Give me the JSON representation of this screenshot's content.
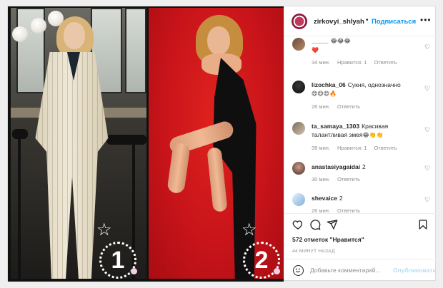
{
  "post": {
    "username": "zirkovyi_shlyah",
    "follow_label": "Подписаться",
    "more_label": "•••",
    "dot": "•"
  },
  "image": {
    "badge_left": "1",
    "badge_right": "2",
    "star_icon": "☆"
  },
  "comments": [
    {
      "user": "_____",
      "text": "",
      "emoji": "😂😂😂",
      "extra": "❤️",
      "time": "34 мин.",
      "likes": "Нравится: 1",
      "reply": "Ответить"
    },
    {
      "user": "lizochka_06",
      "text": "Сукня, однозначно",
      "emoji": "😍😍😍🔥",
      "extra": "",
      "time": "26 мин.",
      "likes": "",
      "reply": "Ответить"
    },
    {
      "user": "ta_samaya_1303",
      "text": "Красивая талантливая змея",
      "emoji": "😂👏👏",
      "extra": "",
      "time": "39 мин.",
      "likes": "Нравится: 1",
      "reply": "Ответить"
    },
    {
      "user": "anastasiyagaidai",
      "text": "2",
      "emoji": "",
      "extra": "",
      "time": "30 мин.",
      "likes": "",
      "reply": "Ответить"
    },
    {
      "user": "shevaice",
      "text": "2",
      "emoji": "",
      "extra": "",
      "time": "26 мин.",
      "likes": "",
      "reply": "Ответить"
    }
  ],
  "footer": {
    "likes_text": "572 отметок \"Нравится\"",
    "time_ago": "44 МИНУТ НАЗАД",
    "comment_placeholder": "Добавьте комментарий...",
    "publish_label": "Опубликовать"
  },
  "colors": {
    "link_blue": "#0095f6",
    "publish_disabled": "#b2dffc",
    "muted": "#8e8e8e"
  }
}
